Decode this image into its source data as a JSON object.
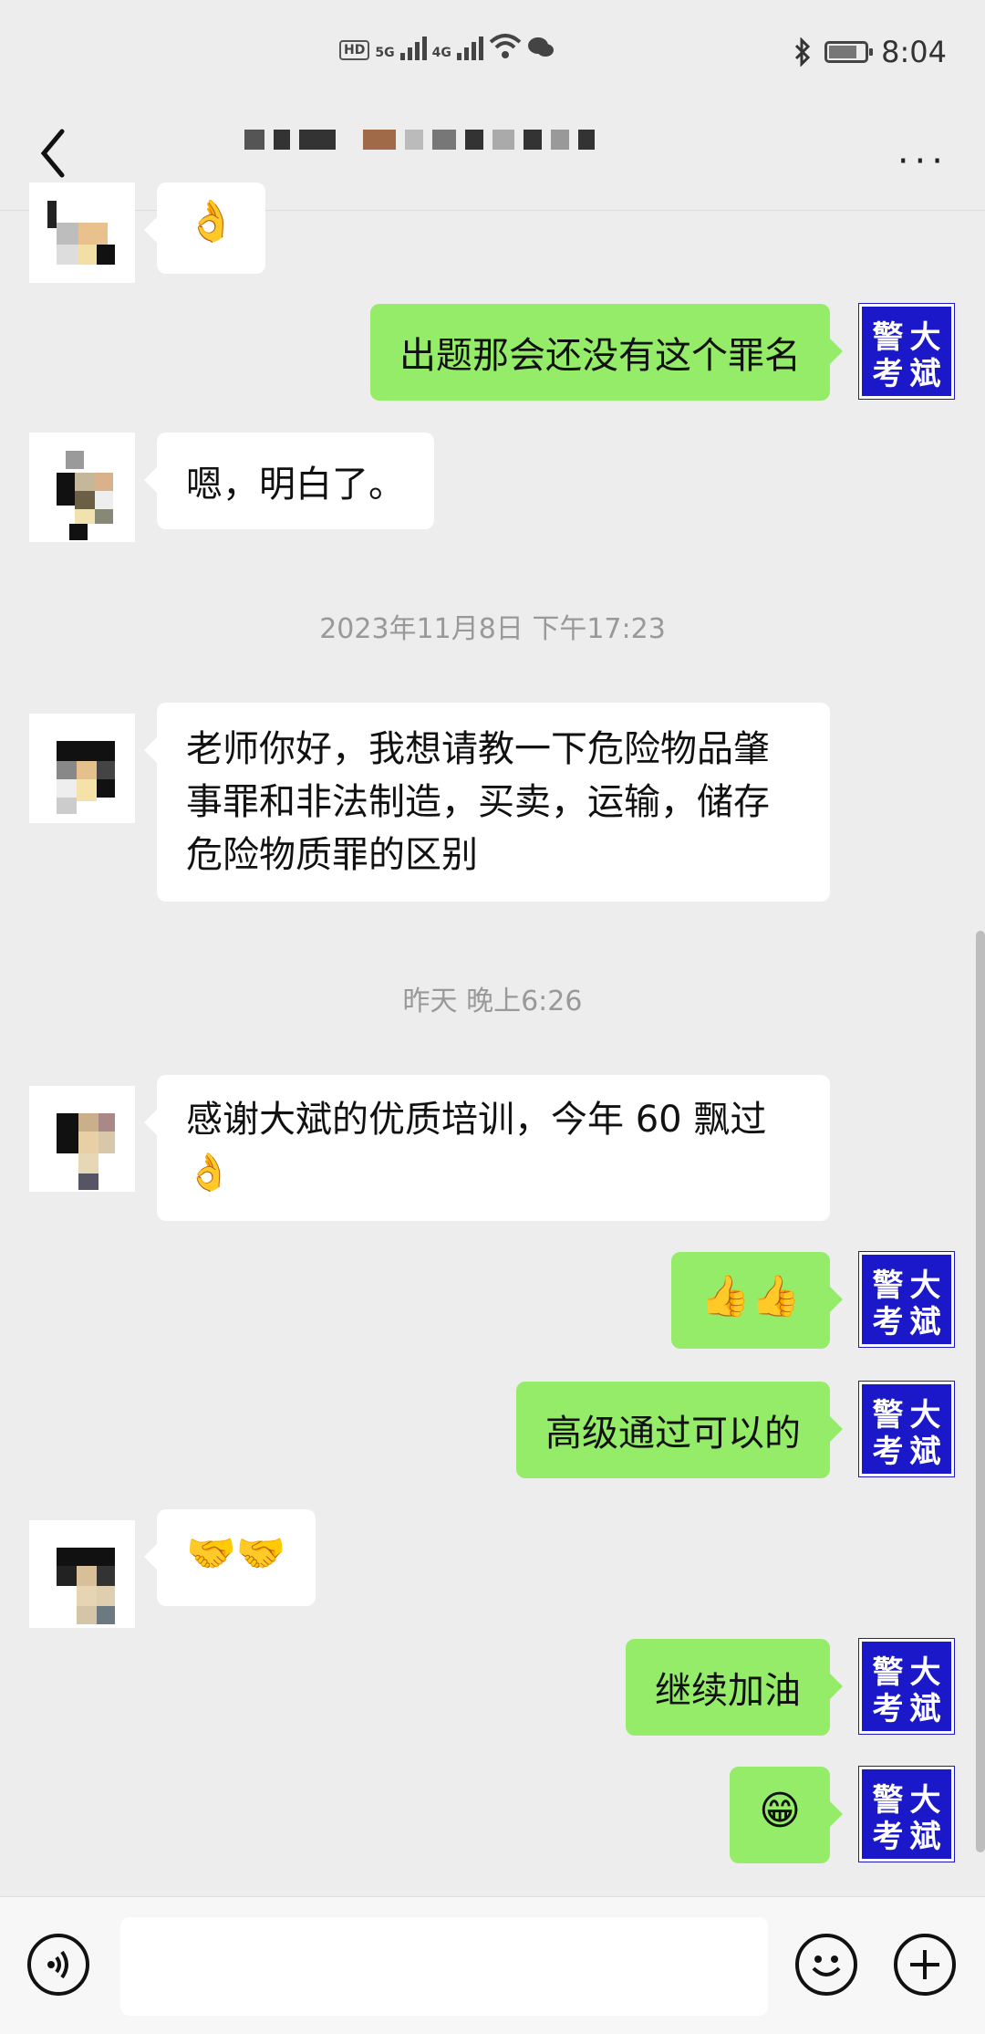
{
  "status_bar": {
    "network_hd": "HD",
    "network_5g": "5G",
    "network_4g": "4G",
    "time": "8:04"
  },
  "header": {
    "more_label": "···"
  },
  "messages": [
    {
      "side": "in",
      "text": "👌"
    },
    {
      "side": "out",
      "text": "出题那会还没有这个罪名"
    },
    {
      "side": "in",
      "text": "嗯，明白了。"
    },
    {
      "type": "time",
      "text": "2023年11月8日 下午17:23"
    },
    {
      "side": "in",
      "text": "老师你好，我想请教一下危险物品肇事罪和非法制造，买卖，运输，储存危险物质罪的区别"
    },
    {
      "type": "time",
      "text": "昨天 晚上6:26"
    },
    {
      "side": "in",
      "text": "感谢大斌的优质培训，今年 60 飘过👌"
    },
    {
      "side": "out",
      "text": "👍👍"
    },
    {
      "side": "out",
      "text": "高级通过可以的"
    },
    {
      "side": "in",
      "text": "🤝🤝"
    },
    {
      "side": "out",
      "text": "继续加油"
    },
    {
      "side": "out",
      "text": "😁"
    }
  ],
  "self_avatar": {
    "chars": [
      "警",
      "大",
      "考",
      "斌"
    ]
  },
  "colors": {
    "outgoing_bubble": "#95ec69",
    "incoming_bubble": "#ffffff",
    "background": "#ededed",
    "avatar_blue": "#1a18c9"
  }
}
